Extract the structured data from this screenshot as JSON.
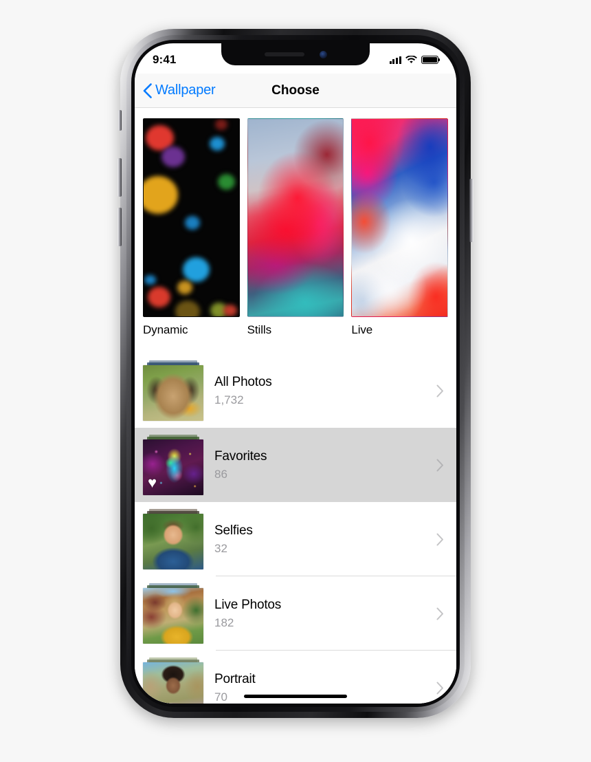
{
  "status_bar": {
    "time": "9:41",
    "signal_icon": "cellular-signal-icon",
    "wifi_icon": "wifi-icon",
    "battery_icon": "battery-full-icon"
  },
  "nav": {
    "back_label": "Wallpaper",
    "back_icon": "chevron-left-icon",
    "title": "Choose"
  },
  "wallpaper_types": [
    {
      "label": "Dynamic",
      "thumb": "dynamic-wallpaper-preview"
    },
    {
      "label": "Stills",
      "thumb": "stills-wallpaper-preview"
    },
    {
      "label": "Live",
      "thumb": "live-wallpaper-preview"
    }
  ],
  "albums": [
    {
      "title": "All Photos",
      "count": "1,732",
      "thumb": "dog-photo",
      "selected": false,
      "badge": ""
    },
    {
      "title": "Favorites",
      "count": "86",
      "thumb": "rainy-night-photo",
      "selected": true,
      "badge": "♥"
    },
    {
      "title": "Selfies",
      "count": "32",
      "thumb": "man-selfie-photo",
      "selected": false,
      "badge": ""
    },
    {
      "title": "Live Photos",
      "count": "182",
      "thumb": "woman-photo",
      "selected": false,
      "badge": ""
    },
    {
      "title": "Portrait",
      "count": "70",
      "thumb": "man-portrait-photo",
      "selected": false,
      "badge": ""
    }
  ],
  "colors": {
    "accent_blue": "#007aff",
    "selected_row": "#d6d6d6",
    "secondary_text": "#9a9a9e",
    "separator": "#dcdcdc"
  },
  "home_indicator": "home-indicator-bar"
}
